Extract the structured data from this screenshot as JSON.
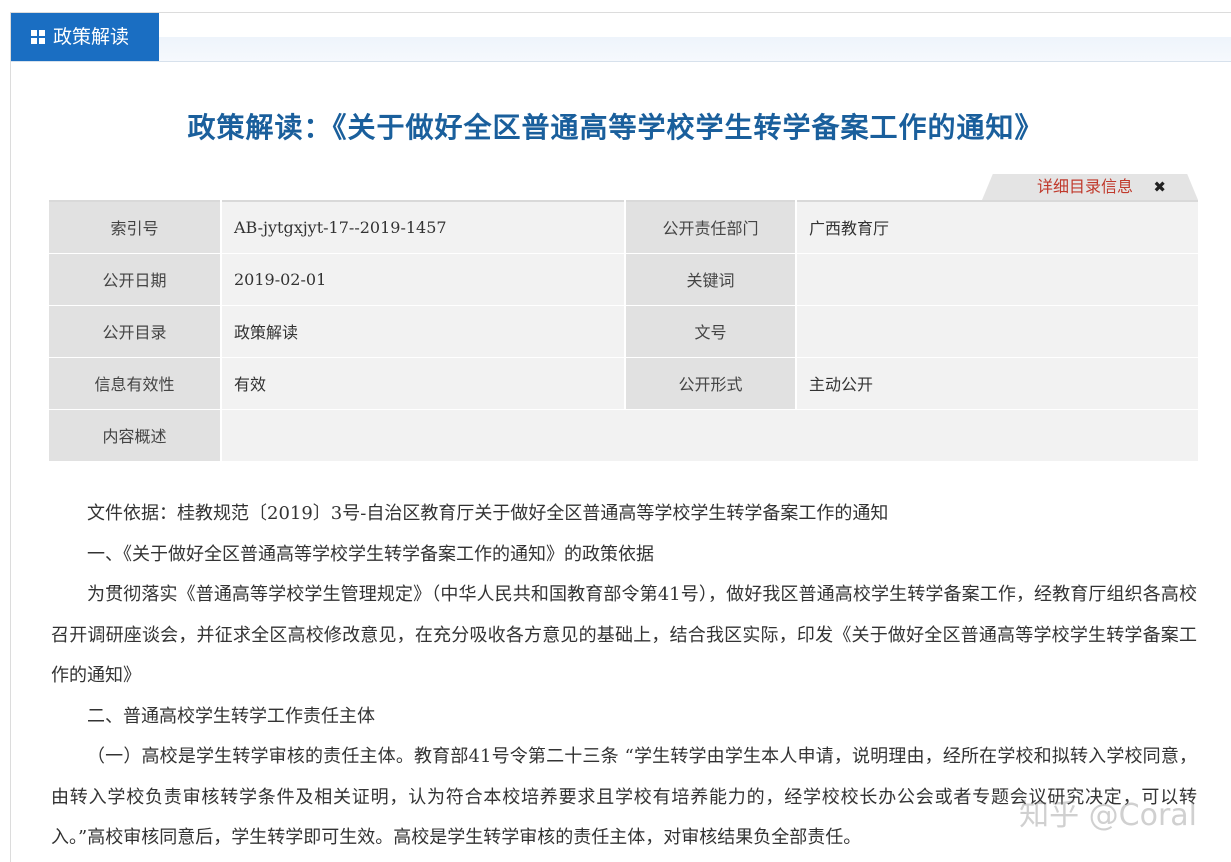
{
  "section_tab": "政策解读",
  "title": "政策解读：《关于做好全区普通高等学校学生转学备案工作的通知》",
  "detail_toggle": {
    "label": "详细目录信息",
    "close": "✖"
  },
  "meta_rows": [
    [
      {
        "label": "索引号",
        "value": "AB-jytgxjyt-17--2019-1457"
      },
      {
        "label": "公开责任部门",
        "value": "广西教育厅"
      }
    ],
    [
      {
        "label": "公开日期",
        "value": "2019-02-01"
      },
      {
        "label": "关键词",
        "value": ""
      }
    ],
    [
      {
        "label": "公开目录",
        "value": "政策解读"
      },
      {
        "label": "文号",
        "value": ""
      }
    ],
    [
      {
        "label": "信息有效性",
        "value": "有效"
      },
      {
        "label": "公开形式",
        "value": "主动公开"
      }
    ],
    [
      {
        "label": "内容概述",
        "value": ""
      }
    ]
  ],
  "paragraphs": [
    "文件依据：桂教规范〔2019〕3号-自治区教育厅关于做好全区普通高等学校学生转学备案工作的通知",
    "一、《关于做好全区普通高等学校学生转学备案工作的通知》的政策依据",
    "为贯彻落实《普通高等学校学生管理规定》（中华人民共和国教育部令第41号），做好我区普通高校学生转学备案工作，经教育厅组织各高校召开调研座谈会，并征求全区高校修改意见，在充分吸收各方意见的基础上，结合我区实际，印发《关于做好全区普通高等学校学生转学备案工作的通知》",
    "二、普通高校学生转学工作责任主体",
    "（一）高校是学生转学审核的责任主体。教育部41号令第二十三条 “学生转学由学生本人申请，说明理由，经所在学校和拟转入学校同意，由转入学校负责审核转学条件及相关证明，认为符合本校培养要求且学校有培养能力的，经学校校长办公会或者专题会议研究决定，可以转入。”高校审核同意后，学生转学即可生效。高校是学生转学审核的责任主体，对审核结果负全部责任。"
  ],
  "watermark": "知乎 @Coral"
}
